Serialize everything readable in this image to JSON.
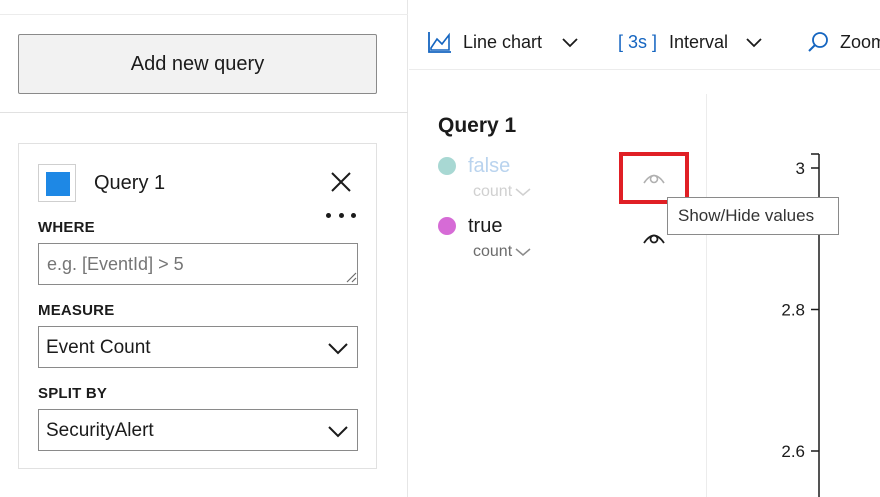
{
  "left_panel": {
    "add_query_label": "Add new query",
    "query": {
      "name": "Query 1",
      "color": "#1e88e5",
      "where_label": "WHERE",
      "where_placeholder": "e.g. [EventId] > 5",
      "where_value": "",
      "measure_label": "MEASURE",
      "measure_value": "Event Count",
      "split_label": "SPLIT BY",
      "split_value": "SecurityAlert"
    }
  },
  "toolbar": {
    "chart_type_label": "Line chart",
    "interval_value": "[ 3s ]",
    "interval_label": "Interval",
    "zoom_label": "Zoom"
  },
  "legend": {
    "title": "Query 1",
    "series": [
      {
        "name": "false",
        "sub": "count",
        "color": "#a8d8d3",
        "text_color": "#b9d3ee",
        "hidden": true
      },
      {
        "name": "true",
        "sub": "count",
        "color": "#d66bd6",
        "text_color": "#1b1b1b",
        "hidden": false
      }
    ],
    "tooltip": "Show/Hide values"
  },
  "chart_data": {
    "type": "line",
    "y_ticks": [
      "3",
      "2.8",
      "2.6"
    ],
    "y_tick_values": [
      3,
      2.8,
      2.6
    ]
  }
}
